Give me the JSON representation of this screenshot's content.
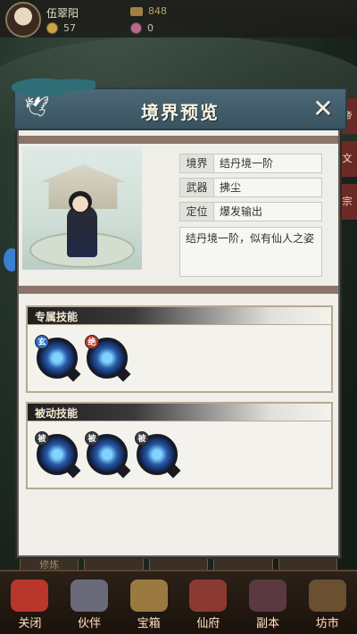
{
  "player": {
    "name": "伍翠阳",
    "coins": "57",
    "jade": "0",
    "scrolls": "848"
  },
  "modal": {
    "title": "境界预览",
    "close_glyph": "✕",
    "info": [
      {
        "key": "境界",
        "value": "结丹境一阶"
      },
      {
        "key": "武器",
        "value": "拂尘"
      },
      {
        "key": "定位",
        "value": "爆发输出"
      }
    ],
    "description": "结丹境一阶，似有仙人之姿",
    "exclusive_skills": {
      "title": "专属技能",
      "items": [
        {
          "tag": "玄",
          "tag_color": "#2f6fc4"
        },
        {
          "tag": "绝",
          "tag_color": "#c23a30"
        }
      ]
    },
    "passive_skills": {
      "title": "被动技能",
      "items": [
        {
          "tag": "被",
          "tag_color": "#3b3b44"
        },
        {
          "tag": "被",
          "tag_color": "#3b3b44"
        },
        {
          "tag": "被",
          "tag_color": "#3b3b44"
        }
      ]
    }
  },
  "behind_tab": "修炼",
  "side_labels": [
    "帝",
    "文",
    "宗"
  ],
  "bottom_nav": [
    {
      "label": "关闭",
      "color": "#b8362c"
    },
    {
      "label": "伙伴",
      "color": "#6a6a7a"
    },
    {
      "label": "宝箱",
      "color": "#9a7a40"
    },
    {
      "label": "仙府",
      "color": "#8a3a30"
    },
    {
      "label": "副本",
      "color": "#5a3a40"
    },
    {
      "label": "坊市",
      "color": "#6a5030"
    }
  ]
}
